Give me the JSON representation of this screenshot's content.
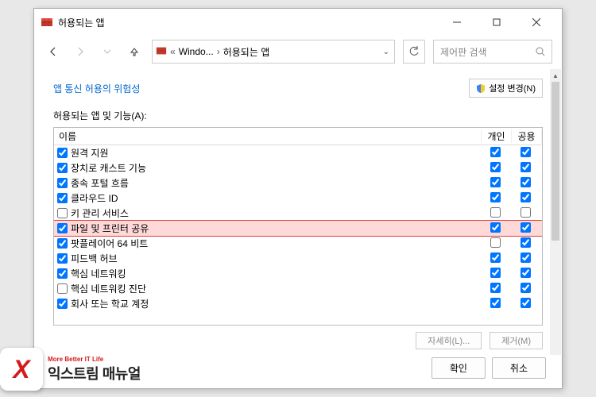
{
  "window": {
    "title": "허용되는 앱"
  },
  "nav": {
    "breadcrumb1": "Windo...",
    "breadcrumb2": "허용되는 앱"
  },
  "search": {
    "placeholder": "제어판 검색"
  },
  "top": {
    "risk_link": "앱 통신 허용의 위험성",
    "change_settings": "설정 변경(N)"
  },
  "section": {
    "label": "허용되는 앱 및 기능(A):"
  },
  "columns": {
    "name": "이름",
    "private": "개인",
    "public": "공용"
  },
  "rows": [
    {
      "name": "원격 지원",
      "enabled": true,
      "private": true,
      "public": true,
      "highlight": false
    },
    {
      "name": "장치로 캐스트 기능",
      "enabled": true,
      "private": true,
      "public": true,
      "highlight": false
    },
    {
      "name": "종속 포털 흐름",
      "enabled": true,
      "private": true,
      "public": true,
      "highlight": false
    },
    {
      "name": "클라우드 ID",
      "enabled": true,
      "private": true,
      "public": true,
      "highlight": false
    },
    {
      "name": "키 관리 서비스",
      "enabled": false,
      "private": false,
      "public": false,
      "highlight": false
    },
    {
      "name": "파일 및 프린터 공유",
      "enabled": true,
      "private": true,
      "public": true,
      "highlight": true
    },
    {
      "name": "팟플레이어 64 비트",
      "enabled": true,
      "private": false,
      "public": true,
      "highlight": false
    },
    {
      "name": "피드백 허브",
      "enabled": true,
      "private": true,
      "public": true,
      "highlight": false
    },
    {
      "name": "핵심 네트워킹",
      "enabled": true,
      "private": true,
      "public": true,
      "highlight": false
    },
    {
      "name": "핵심 네트워킹 진단",
      "enabled": false,
      "private": true,
      "public": true,
      "highlight": false
    },
    {
      "name": "회사 또는 학교 계정",
      "enabled": true,
      "private": true,
      "public": true,
      "highlight": false
    }
  ],
  "buttons": {
    "details": "자세히(L)...",
    "remove": "제거(M)",
    "ok": "확인",
    "cancel": "취소"
  },
  "logo": {
    "main": "익스트림 매뉴얼",
    "sub": "More Better IT Life"
  }
}
